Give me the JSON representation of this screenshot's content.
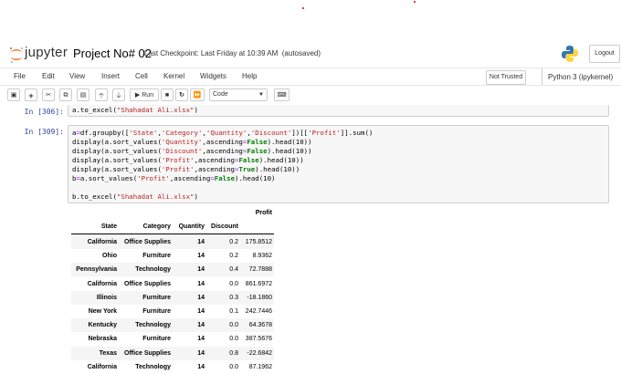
{
  "header": {
    "logo_text": "jupyter",
    "notebook_title": "Project No# 02",
    "checkpoint": "Last Checkpoint: Last Friday at 10:39 AM",
    "autosave": "(autosaved)",
    "logout_label": "Logout"
  },
  "menubar": {
    "items": [
      "File",
      "Edit",
      "View",
      "Insert",
      "Cell",
      "Kernel",
      "Widgets",
      "Help"
    ],
    "trust_label": "Not Trusted",
    "kernel_label": "Python 3 (ipykernel)"
  },
  "toolbar": {
    "run_label": "Run",
    "cell_type": "Code"
  },
  "cells": [
    {
      "prompt": "In [306]:",
      "code": "a.to_excel(\"Shahadat Ali.xlsx\")"
    },
    {
      "prompt": "In [309]:",
      "lines": [
        "a=df.groupby(['State','Category','Quantity','Discount'])[['Profit']].sum()",
        "display(a.sort_values('Quantity',ascending=False).head(10))",
        "display(a.sort_values('Discount',ascending=False).head(10))",
        "display(a.sort_values('Profit',ascending=False).head(10))",
        "display(a.sort_values('Profit',ascending=True).head(10))",
        "b=a.sort_values('Profit',ascending=False).head(10)",
        "",
        "b.to_excel(\"Shahadat Ali.xlsx\")"
      ]
    }
  ],
  "output": {
    "value_header": "Profit",
    "index_headers": [
      "State",
      "Category",
      "Quantity",
      "Discount"
    ],
    "rows": [
      [
        "California",
        "Office Supplies",
        "14",
        "0.2",
        "175.8512"
      ],
      [
        "Ohio",
        "Furniture",
        "14",
        "0.2",
        "8.9362"
      ],
      [
        "Pennsylvania",
        "Technology",
        "14",
        "0.4",
        "72.7888"
      ],
      [
        "California",
        "Office Supplies",
        "14",
        "0.0",
        "861.6972"
      ],
      [
        "Illinois",
        "Furniture",
        "14",
        "0.3",
        "-18.1860"
      ],
      [
        "New York",
        "Furniture",
        "14",
        "0.1",
        "242.7446"
      ],
      [
        "Kentucky",
        "Technology",
        "14",
        "0.0",
        "64.3678"
      ],
      [
        "Nebraska",
        "Furniture",
        "14",
        "0.0",
        "387.5676"
      ],
      [
        "Texas",
        "Office Supplies",
        "14",
        "0.8",
        "-22.6842"
      ],
      [
        "California",
        "Technology",
        "14",
        "0.0",
        "87.1962"
      ]
    ]
  }
}
